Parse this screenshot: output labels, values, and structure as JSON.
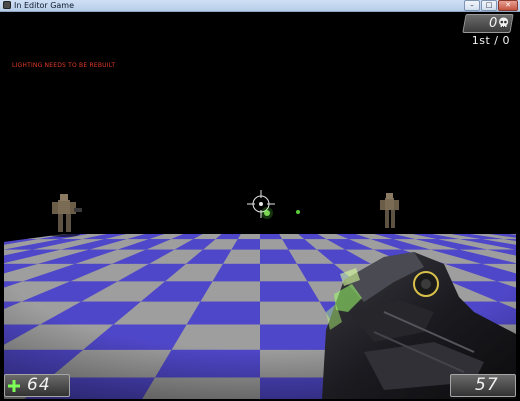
{
  "window": {
    "title": "In Editor Game",
    "icon": "unreal-app-icon",
    "controls": [
      "minimize",
      "maximize",
      "close"
    ]
  },
  "hud": {
    "warning_text": "LIGHTING NEEDS TO BE REBUILT",
    "warning_color": "#e23a2a",
    "score": "0",
    "score_icon": "skull-icon",
    "rank": "1st / 0",
    "health": "64",
    "health_icon": "plus-icon",
    "ammo": "57"
  },
  "scene": {
    "floor_colors": [
      "#4f47c9",
      "#9e9e9e"
    ],
    "background": "#000000",
    "crosshair_color": "#e6e6e6"
  }
}
